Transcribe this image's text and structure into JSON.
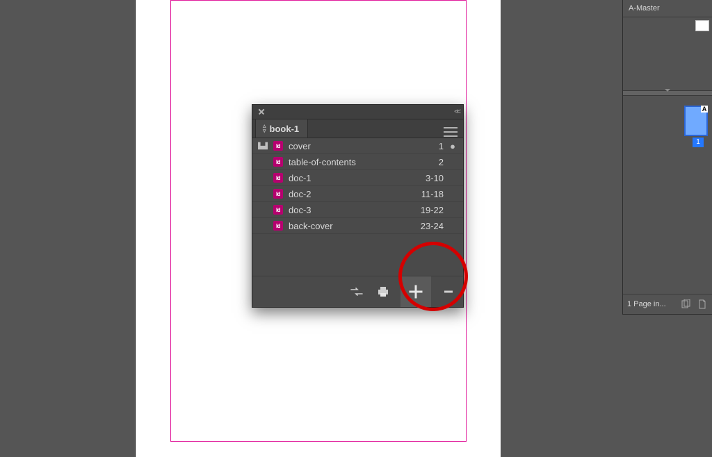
{
  "pagesPanel": {
    "masterLabel": "A-Master",
    "pageThumbLetter": "A",
    "pageThumbNumber": "1",
    "footerLabel": "1 Page in..."
  },
  "bookPanel": {
    "tabTitle": "book-1",
    "documents": [
      {
        "name": "cover",
        "range": "1",
        "isStyleSource": true,
        "isOpen": true
      },
      {
        "name": "table-of-contents",
        "range": "2",
        "isStyleSource": false,
        "isOpen": false
      },
      {
        "name": "doc-1",
        "range": "3-10",
        "isStyleSource": false,
        "isOpen": false
      },
      {
        "name": "doc-2",
        "range": "11-18",
        "isStyleSource": false,
        "isOpen": false
      },
      {
        "name": "doc-3",
        "range": "19-22",
        "isStyleSource": false,
        "isOpen": false
      },
      {
        "name": "back-cover",
        "range": "23-24",
        "isStyleSource": false,
        "isOpen": false
      }
    ]
  }
}
